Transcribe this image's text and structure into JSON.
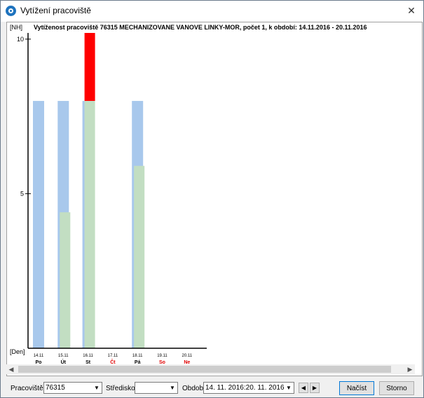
{
  "window": {
    "title": "Vytížení pracoviště",
    "close_label": "✕"
  },
  "chart_header": {
    "unit": "[NH]",
    "title": "Vytíženost pracoviště 76315 MECHANIZOVANE VANOVE LINKY-MOR, počet 1, k období: 14.11.2016 - 20.11.2016",
    "x_unit": "[Den]"
  },
  "chart_data": {
    "type": "bar",
    "categories": [
      "14.11",
      "15.11",
      "16.11",
      "17.11",
      "18.11",
      "19.11",
      "20.11"
    ],
    "day_names": [
      "Po",
      "Út",
      "St",
      "Čt",
      "Pá",
      "So",
      "Ne"
    ],
    "weekend_or_holiday": [
      false,
      false,
      false,
      true,
      false,
      true,
      true
    ],
    "series": [
      {
        "values": [
          8,
          8,
          8,
          0,
          8,
          0,
          0
        ],
        "color": "#a8c8ec"
      },
      {
        "values": [
          0,
          4.4,
          8,
          0,
          5.9,
          0,
          0
        ],
        "color": "#c2dec2"
      },
      {
        "values": [
          0,
          0,
          2.2,
          0,
          0,
          0,
          0
        ],
        "color": "#ff0000"
      }
    ],
    "ylim": [
      0,
      10.2
    ],
    "yticks": [
      5,
      10
    ],
    "grid": false,
    "colors": {
      "red_day_label": "#e00000"
    }
  },
  "bottom": {
    "pracoviste_label": "Pracoviště:",
    "pracoviste_value": "76315",
    "stredisko_label": "Středisko:",
    "stredisko_value": "",
    "obdobi_label": "Období:",
    "obdobi_value": "14. 11. 2016:20. 11. 2016",
    "load_button": "Načíst",
    "cancel_button": "Storno"
  }
}
